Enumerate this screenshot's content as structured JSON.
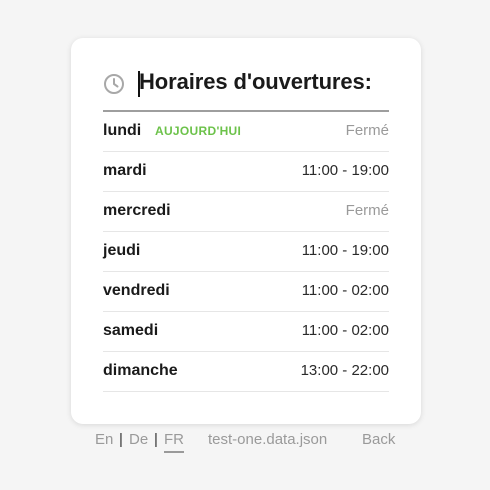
{
  "header": {
    "title": "Horaires d'ouvertures:",
    "icon": "clock-icon"
  },
  "schedule": [
    {
      "day": "lundi",
      "badge": "AUJOURD'HUI",
      "hours": "Fermé",
      "closed": true
    },
    {
      "day": "mardi",
      "badge": "",
      "hours": "11:00 - 19:00",
      "closed": false
    },
    {
      "day": "mercredi",
      "badge": "",
      "hours": "Fermé",
      "closed": true
    },
    {
      "day": "jeudi",
      "badge": "",
      "hours": "11:00 - 19:00",
      "closed": false
    },
    {
      "day": "vendredi",
      "badge": "",
      "hours": "11:00 - 02:00",
      "closed": false
    },
    {
      "day": "samedi",
      "badge": "",
      "hours": "11:00 - 02:00",
      "closed": false
    },
    {
      "day": "dimanche",
      "badge": "",
      "hours": "13:00 - 22:00",
      "closed": false
    }
  ],
  "footer": {
    "languages": [
      "En",
      "De",
      "FR"
    ],
    "active_language": "FR",
    "separator": "|",
    "file_link": "test-one.data.json",
    "back_label": "Back"
  },
  "colors": {
    "today_badge": "#6cc24a",
    "closed_text": "#9a9a9a",
    "background": "#f5f5f5",
    "card": "#ffffff"
  }
}
